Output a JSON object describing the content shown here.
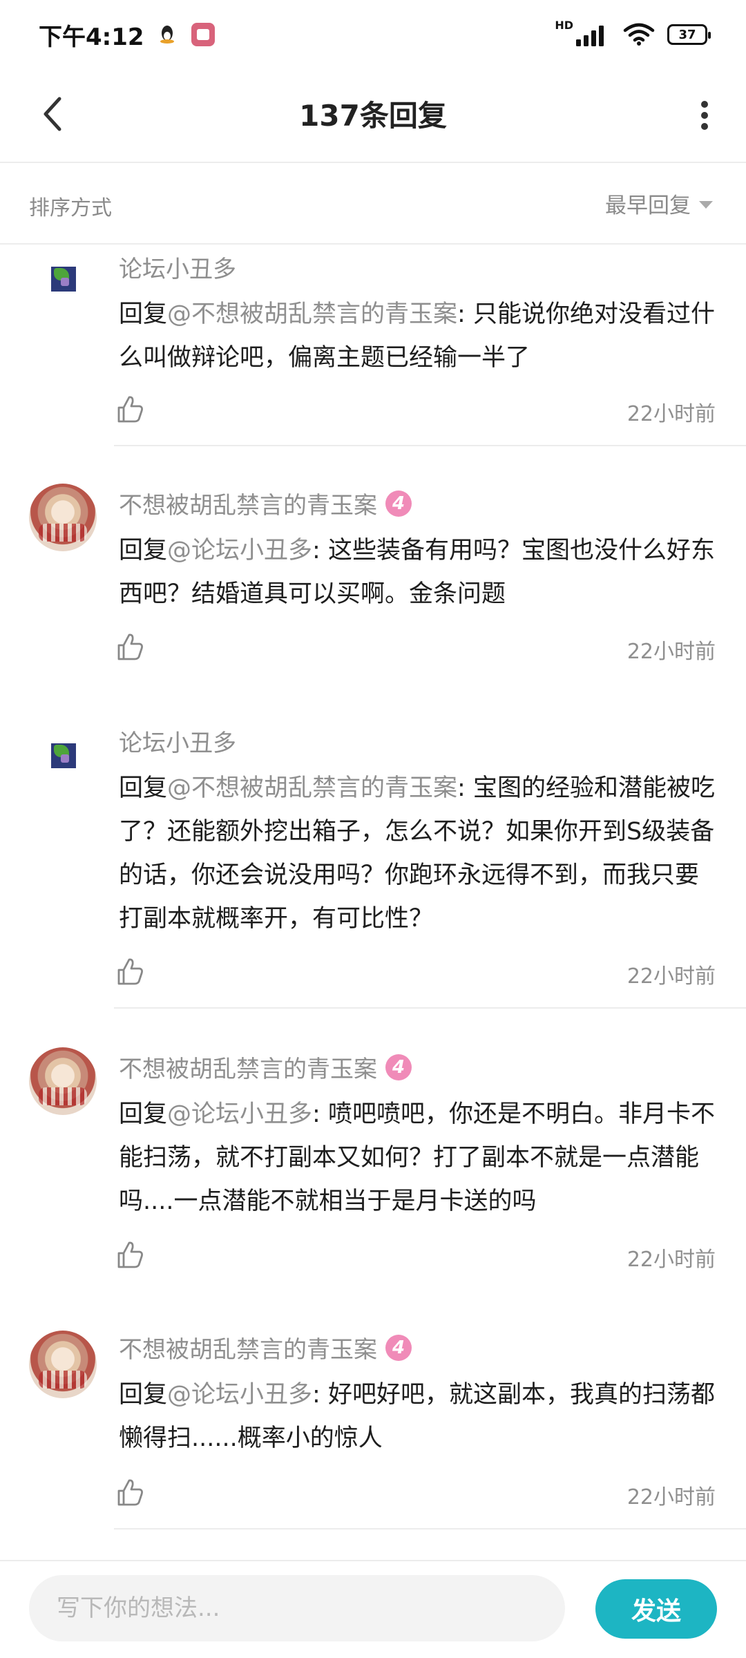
{
  "status_bar": {
    "time": "下午4:12",
    "network_tag": "HD",
    "battery": "37"
  },
  "header": {
    "title": "137条回复"
  },
  "sort_bar": {
    "label": "排序方式",
    "selected": "最早回复"
  },
  "comments": [
    {
      "author": "论坛小丑多",
      "reply_prefix": "回复",
      "mention": "@不想被胡乱禁言的青玉案",
      "text": ": 只能说你绝对没看过什么叫做辩论吧，偏离主题已经输一半了",
      "time": "22小时前"
    },
    {
      "author": "不想被胡乱禁言的青玉案",
      "level": "4",
      "reply_prefix": "回复",
      "mention": "@论坛小丑多",
      "text": ": 这些装备有用吗？宝图也没什么好东西吧？结婚道具可以买啊。金条问题",
      "time": "22小时前"
    },
    {
      "author": "论坛小丑多",
      "reply_prefix": "回复",
      "mention": "@不想被胡乱禁言的青玉案",
      "text": ": 宝图的经验和潜能被吃了？还能额外挖出箱子，怎么不说？如果你开到S级装备的话，你还会说没用吗？你跑环永远得不到，而我只要打副本就概率开，有可比性？",
      "time": "22小时前"
    },
    {
      "author": "不想被胡乱禁言的青玉案",
      "level": "4",
      "reply_prefix": "回复",
      "mention": "@论坛小丑多",
      "text": ": 喷吧喷吧，你还是不明白。非月卡不能扫荡，就不打副本又如何？打了副本不就是一点潜能吗....一点潜能不就相当于是月卡送的吗",
      "time": "22小时前"
    },
    {
      "author": "不想被胡乱禁言的青玉案",
      "level": "4",
      "reply_prefix": "回复",
      "mention": "@论坛小丑多",
      "text": ": 好吧好吧，就这副本，我真的扫荡都懒得扫......概率小的惊人",
      "time": "22小时前"
    }
  ],
  "bottom_bar": {
    "placeholder": "写下你的想法...",
    "send_label": "发送"
  },
  "colors": {
    "accent": "#1db5c3",
    "level_badge": "#f08bb8",
    "muted_text": "#8f8f8f"
  }
}
